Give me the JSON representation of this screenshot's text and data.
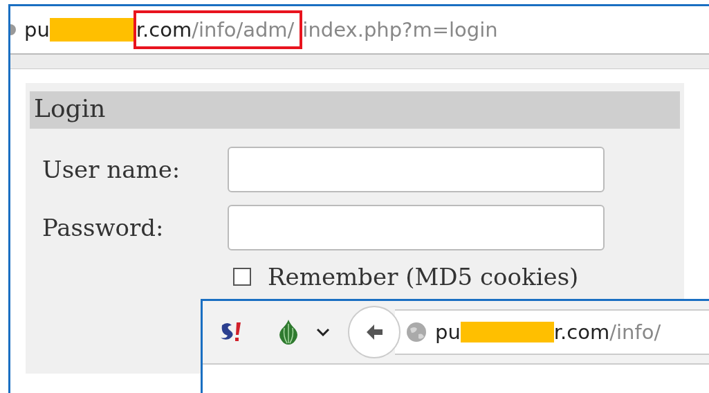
{
  "background_window": {
    "address_bar": {
      "url_host_start": "pu",
      "url_host_end": "r.com",
      "url_path_highlighted": "/info/adm/",
      "url_path_rest": "index.php?m=login",
      "redacted": true,
      "highlighted": true
    },
    "login_panel": {
      "title": "Login",
      "fields": [
        {
          "label": "User name:"
        },
        {
          "label": "Password:"
        }
      ],
      "remember": {
        "label": "Remember (MD5 cookies)",
        "checked": false
      }
    }
  },
  "foreground_window": {
    "address_bar": {
      "url_host_start": "pu",
      "url_host_end": "r.com",
      "url_path": "/info/",
      "redacted": true
    }
  }
}
